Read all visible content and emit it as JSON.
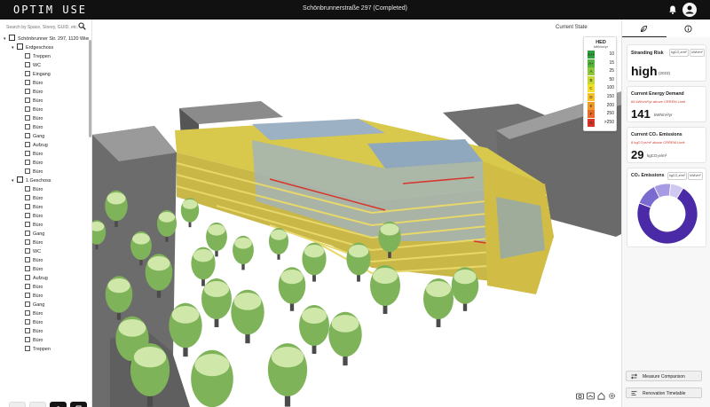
{
  "app": {
    "logo": "OPTIM USE",
    "document_title": "Schönbrunnerstraße 297 (Completed)"
  },
  "header_icons": [
    "bell-icon",
    "user-icon"
  ],
  "search": {
    "placeholder": "Search by Space, Storey, GUID, etc."
  },
  "tree": {
    "building": "Schönbrunner Str. 297, 1120 Wien",
    "floors": [
      {
        "name": "Erdgeschoss",
        "items": [
          "Treppen",
          "WC",
          "Eingang",
          "Büro",
          "Büro",
          "Büro",
          "Büro",
          "Büro",
          "Büro",
          "Gang",
          "Aufzug",
          "Büro",
          "Büro",
          "Büro"
        ]
      },
      {
        "name": "1.Geschoss",
        "items": [
          "Büro",
          "Büro",
          "Büro",
          "Büro",
          "Büro",
          "Gang",
          "Büro",
          "WC",
          "Büro",
          "Büro",
          "Aufzug",
          "Büro",
          "Büro",
          "Gang",
          "Büro",
          "Büro",
          "Büro",
          "Büro",
          "Treppen"
        ]
      }
    ]
  },
  "viewport": {
    "state_label": "Current State",
    "legend": {
      "title": "HED",
      "unit": "kWh/m²/yr",
      "rows": [
        {
          "class": "A++",
          "value": "10",
          "color": "#2e9e3e"
        },
        {
          "class": "A+",
          "value": "15",
          "color": "#58b33f"
        },
        {
          "class": "A",
          "value": "25",
          "color": "#8fc640"
        },
        {
          "class": "B",
          "value": "50",
          "color": "#c6d634"
        },
        {
          "class": "C",
          "value": "100",
          "color": "#f2e12a"
        },
        {
          "class": "D",
          "value": "150",
          "color": "#f6c02a"
        },
        {
          "class": "E",
          "value": "200",
          "color": "#f09a2a"
        },
        {
          "class": "F",
          "value": "250",
          "color": "#e86a2a"
        },
        {
          "class": "G",
          "value": ">250",
          "color": "#d9342a"
        }
      ]
    },
    "bottom_icons": [
      "camera-icon",
      "layers-icon",
      "home-icon",
      "settings-icon"
    ]
  },
  "right_panel": {
    "tabs": [
      "leaf-icon",
      "info-icon"
    ],
    "stranding": {
      "title": "Stranding Risk",
      "unit_a": "kgCO₂e/m²",
      "unit_b": "kWh/m²",
      "value": "high",
      "year": "(2023)"
    },
    "energy": {
      "title": "Current Energy Demand",
      "note": "66 kWh/m²/yr above CRREM Limit",
      "value": "141",
      "unit": "kWh/m²/yr"
    },
    "emissions": {
      "title": "Current CO₂ Emissions",
      "note": "8 kgCO₂e/m² above CRREM Limit",
      "value": "29",
      "unit": "kgCO₂e/m²"
    },
    "co2_card": {
      "title": "CO₂ Emissions",
      "unit_a": "kgCO₂e/m²",
      "unit_b": "kWh/m²",
      "donut": [
        {
          "share": 0.72,
          "color": "#4a2aa6"
        },
        {
          "share": 0.12,
          "color": "#7a6bd0"
        },
        {
          "share": 0.09,
          "color": "#a79be3"
        },
        {
          "share": 0.07,
          "color": "#cfc8f1"
        }
      ]
    },
    "buttons": {
      "measure": "Measure Comparison",
      "timetable": "Renovation Timetable"
    }
  }
}
